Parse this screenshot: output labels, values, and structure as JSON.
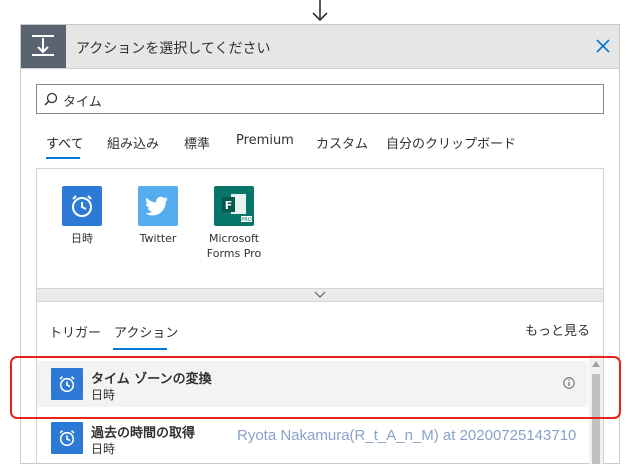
{
  "header": {
    "title": "アクションを選択してください",
    "icon": "flow-step-icon",
    "close_icon": "close-icon"
  },
  "search": {
    "value": "タイム",
    "placeholder": "",
    "icon": "search-icon"
  },
  "tabs": [
    {
      "label": "すべて",
      "active": true
    },
    {
      "label": "組み込み"
    },
    {
      "label": "標準"
    },
    {
      "label": "Premium"
    },
    {
      "label": "カスタム"
    },
    {
      "label": "自分のクリップボード"
    }
  ],
  "connectors": [
    {
      "label": "日時",
      "icon": "alarm-clock-icon",
      "color": "#2d7ad6"
    },
    {
      "label": "Twitter",
      "icon": "twitter-bird-icon",
      "color": "#55acee"
    },
    {
      "label": "Microsoft Forms Pro",
      "label_line1": "Microsoft",
      "label_line2": "Forms Pro",
      "icon": "forms-pro-icon",
      "color": "#077568"
    }
  ],
  "subtabs": [
    {
      "label": "トリガー"
    },
    {
      "label": "アクション",
      "active": true
    }
  ],
  "see_more": "もっと見る",
  "actions": [
    {
      "title": "タイム ゾーンの変換",
      "subtitle": "日時",
      "selected": true
    },
    {
      "title": "過去の時間の取得",
      "subtitle": "日時"
    }
  ],
  "watermark": "Ryota Nakamura(R_t_A_n_M) at 20200725143710",
  "colors": {
    "accent": "#0078d4",
    "highlight": "#e8231d",
    "header_bg": "#e6e6e6"
  }
}
